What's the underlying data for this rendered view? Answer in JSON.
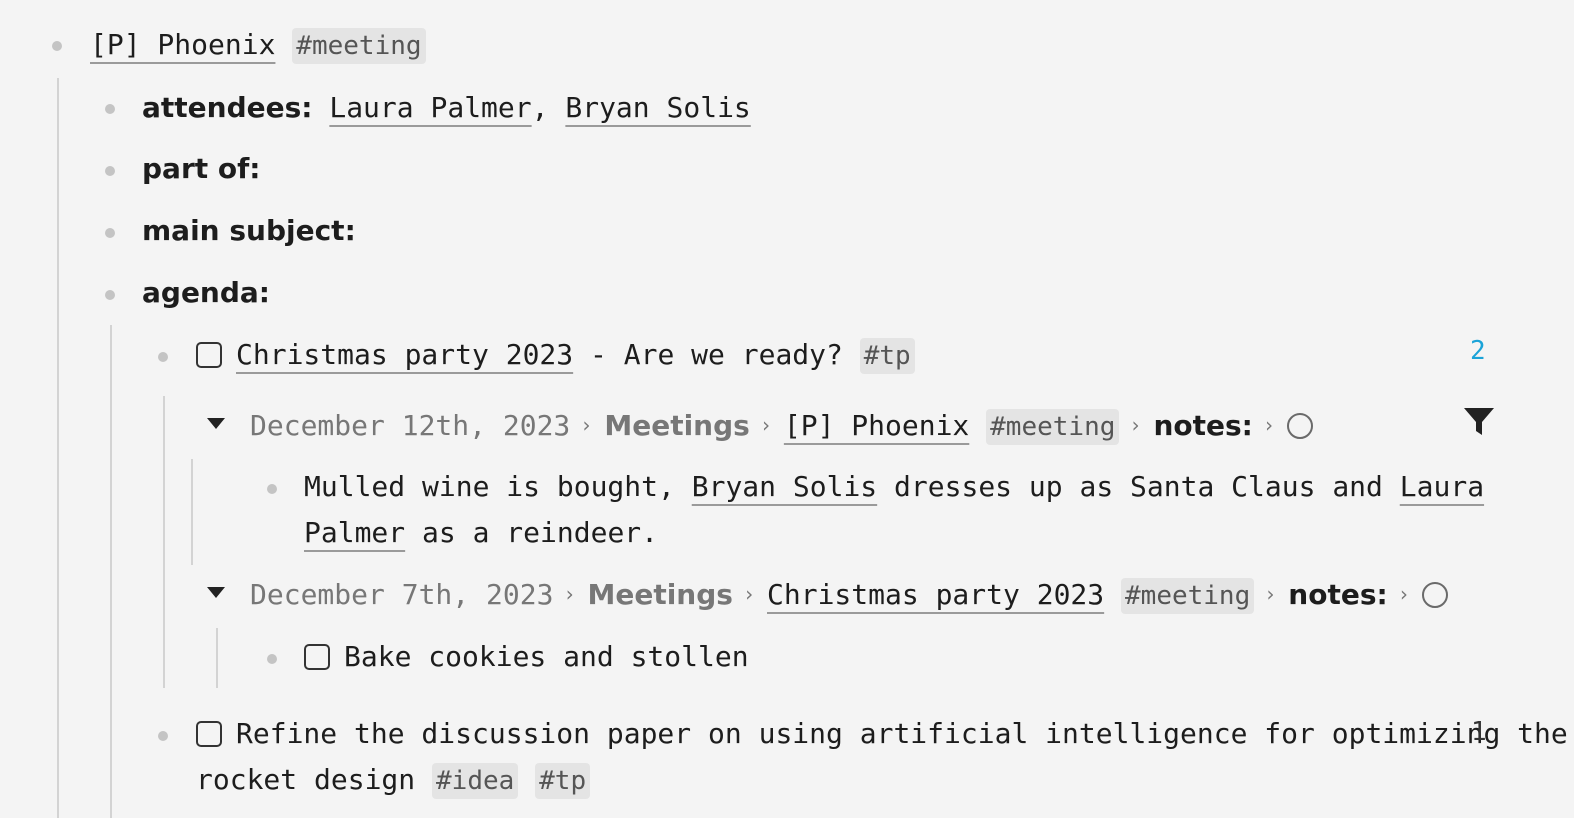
{
  "root": {
    "title": "[P] Phoenix",
    "tag": "#meeting"
  },
  "fields": {
    "attendees_label": "attendees:",
    "attendee1": "Laura Palmer",
    "attendee_sep": ",",
    "attendee2": "Bryan Solis",
    "part_of_label": "part of:",
    "main_subject_label": "main subject:",
    "agenda_label": "agenda:"
  },
  "agenda": {
    "item1": {
      "link": "Christmas party 2023",
      "text": " - Are we ready?",
      "tag": "#tp",
      "count": "2"
    },
    "ref1": {
      "date": "December 12th, 2023",
      "folder": "Meetings",
      "page": "[P] Phoenix",
      "tag": "#meeting",
      "field": "notes:",
      "note_text1": "Mulled wine is bought,",
      "note_link1": "Bryan Solis",
      "note_text2": "dresses up as Santa Claus and",
      "note_link2a": "Laura",
      "note_link2b": "Palmer",
      "note_text3": "as a reindeer."
    },
    "ref2": {
      "date": "December 7th, 2023",
      "folder": "Meetings",
      "page": "Christmas party 2023",
      "tag": "#meeting",
      "field": "notes:",
      "task": "Bake cookies and stollen"
    },
    "item2": {
      "line1": "Refine the discussion paper on using artificial intelligence for optimizing the",
      "line2": "rocket design",
      "tag1": "#idea",
      "tag2": "#tp",
      "count": "1"
    }
  },
  "icons": {
    "filter": "filter-icon",
    "status": "circle-status-icon",
    "checkbox": "checkbox-icon",
    "collapse": "collapse-triangle-icon"
  },
  "colors": {
    "accent_count": "#1aa3d8",
    "tag_bg": "#e4e4e4",
    "background": "#f4f4f4"
  }
}
